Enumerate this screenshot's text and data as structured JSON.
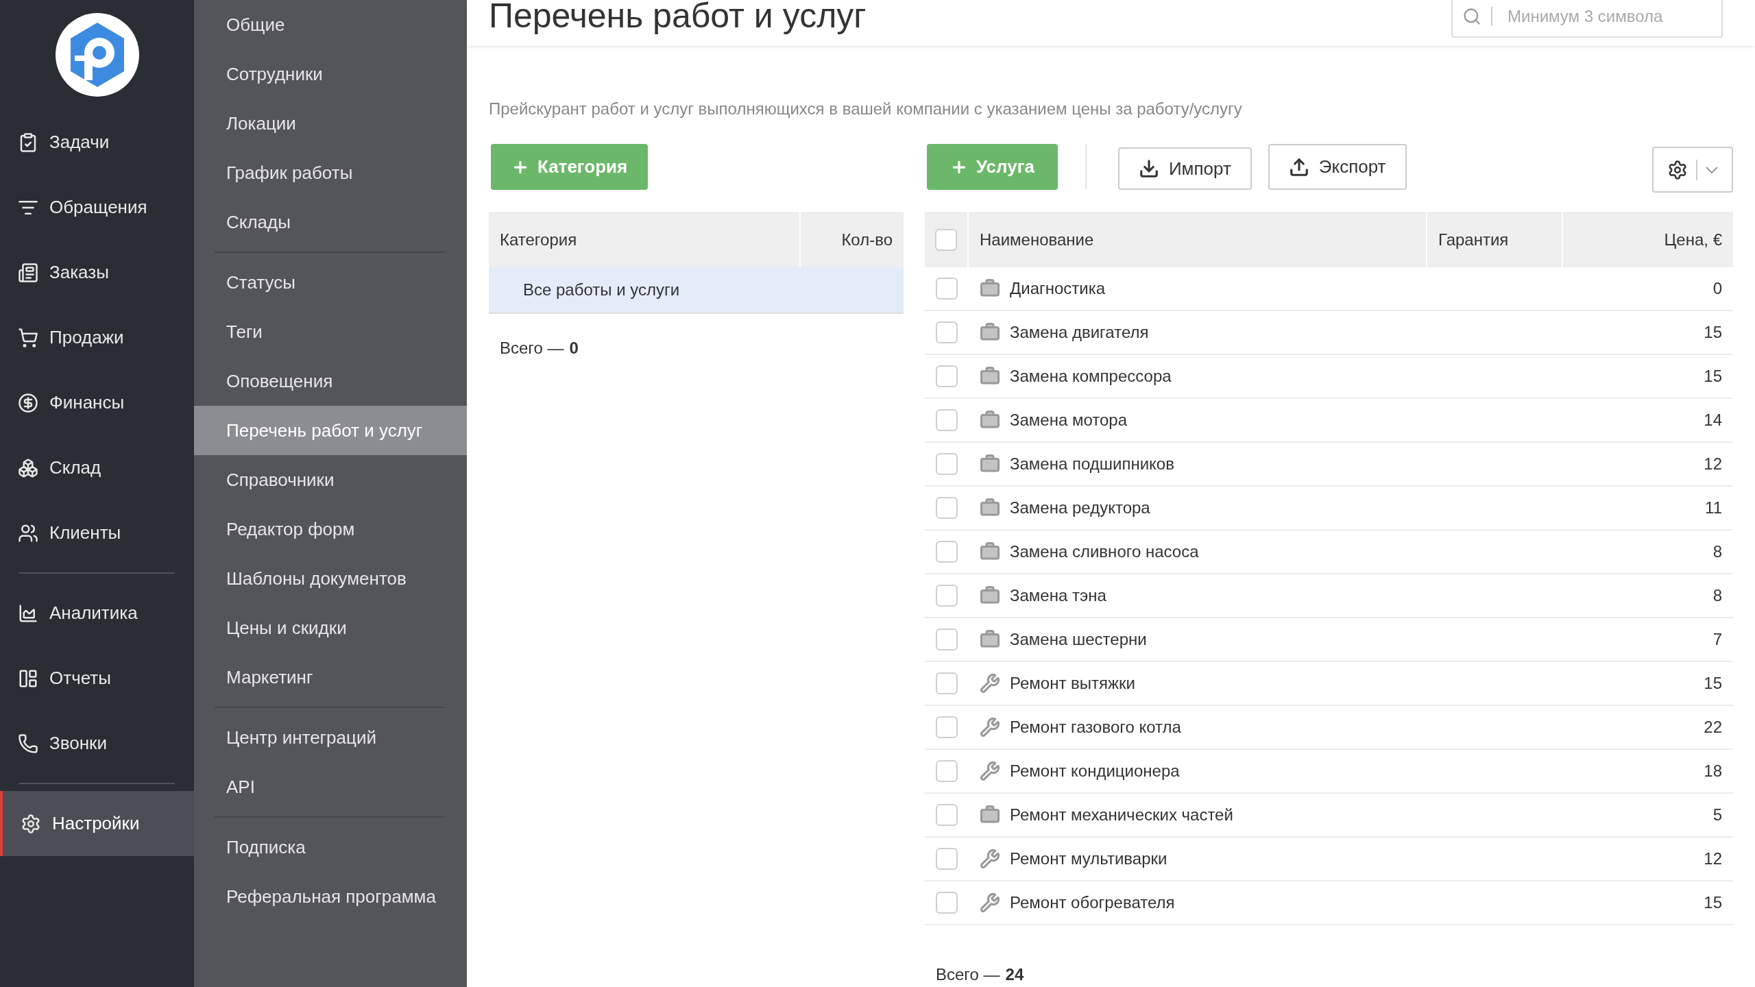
{
  "main_nav": {
    "groups": [
      [
        {
          "label": "Задачи",
          "selected": false
        },
        {
          "label": "Обращения",
          "selected": false
        },
        {
          "label": "Заказы",
          "selected": false
        },
        {
          "label": "Продажи",
          "selected": false
        },
        {
          "label": "Финансы",
          "selected": false
        },
        {
          "label": "Склад",
          "selected": false
        },
        {
          "label": "Клиенты",
          "selected": false
        }
      ],
      [
        {
          "label": "Аналитика",
          "selected": false
        },
        {
          "label": "Отчеты",
          "selected": false
        },
        {
          "label": "Звонки",
          "selected": false
        }
      ],
      [
        {
          "label": "Настройки",
          "selected": true
        }
      ]
    ]
  },
  "settings_nav": {
    "groups": [
      [
        {
          "label": "Общие",
          "selected": false
        },
        {
          "label": "Сотрудники",
          "selected": false
        },
        {
          "label": "Локации",
          "selected": false
        },
        {
          "label": "График работы",
          "selected": false
        },
        {
          "label": "Склады",
          "selected": false
        }
      ],
      [
        {
          "label": "Статусы",
          "selected": false
        },
        {
          "label": "Теги",
          "selected": false
        },
        {
          "label": "Оповещения",
          "selected": false
        },
        {
          "label": "Перечень работ и услуг",
          "selected": true
        },
        {
          "label": "Справочники",
          "selected": false
        },
        {
          "label": "Редактор форм",
          "selected": false
        },
        {
          "label": "Шаблоны документов",
          "selected": false
        },
        {
          "label": "Цены и скидки",
          "selected": false
        },
        {
          "label": "Маркетинг",
          "selected": false
        }
      ],
      [
        {
          "label": "Центр интеграций",
          "selected": false
        },
        {
          "label": "API",
          "selected": false
        }
      ],
      [
        {
          "label": "Подписка",
          "selected": false
        },
        {
          "label": "Реферальная программа",
          "selected": false
        }
      ]
    ]
  },
  "page": {
    "title": "Перечень работ и услуг",
    "search": {
      "placeholder": "Минимум 3 символа"
    },
    "description": "Прейскурант работ и услуг выполняющихся в вашей компании с указанием цены за работу/услугу"
  },
  "categories": {
    "add_button": "Категория",
    "columns": [
      "Категория",
      "Кол-во"
    ],
    "rows": [
      {
        "name": "Все работы и услуги",
        "selected": true
      }
    ],
    "total_label": "Всего —",
    "total": "0"
  },
  "services": {
    "add_button": "Услуга",
    "import_button": "Импорт",
    "export_button": "Экспорт",
    "columns": [
      "Наименование",
      "Гарантия",
      "Цена, €"
    ],
    "all_checked": false,
    "rows": [
      {
        "kind": "service",
        "name": "Диагностика",
        "price": "0",
        "checked": false
      },
      {
        "kind": "service",
        "name": "Замена двигателя",
        "price": "15",
        "checked": false
      },
      {
        "kind": "service",
        "name": "Замена компрессора",
        "price": "15",
        "checked": false
      },
      {
        "kind": "service",
        "name": "Замена мотора",
        "price": "14",
        "checked": false
      },
      {
        "kind": "service",
        "name": "Замена подшипников",
        "price": "12",
        "checked": false
      },
      {
        "kind": "service",
        "name": "Замена редуктора",
        "price": "11",
        "checked": false
      },
      {
        "kind": "service",
        "name": "Замена сливного насоса",
        "price": "8",
        "checked": false
      },
      {
        "kind": "service",
        "name": "Замена тэна",
        "price": "8",
        "checked": false
      },
      {
        "kind": "service",
        "name": "Замена шестерни",
        "price": "7",
        "checked": false
      },
      {
        "kind": "repair",
        "name": "Ремонт вытяжки",
        "price": "15",
        "checked": false
      },
      {
        "kind": "repair",
        "name": "Ремонт газового котла",
        "price": "22",
        "checked": false
      },
      {
        "kind": "repair",
        "name": "Ремонт кондиционера",
        "price": "18",
        "checked": false
      },
      {
        "kind": "service",
        "name": "Ремонт механических частей",
        "price": "5",
        "checked": false
      },
      {
        "kind": "repair",
        "name": "Ремонт мультиварки",
        "price": "12",
        "checked": false
      },
      {
        "kind": "repair",
        "name": "Ремонт обогревателя",
        "price": "15",
        "checked": false
      }
    ],
    "total_label": "Всего —",
    "total": "24"
  }
}
